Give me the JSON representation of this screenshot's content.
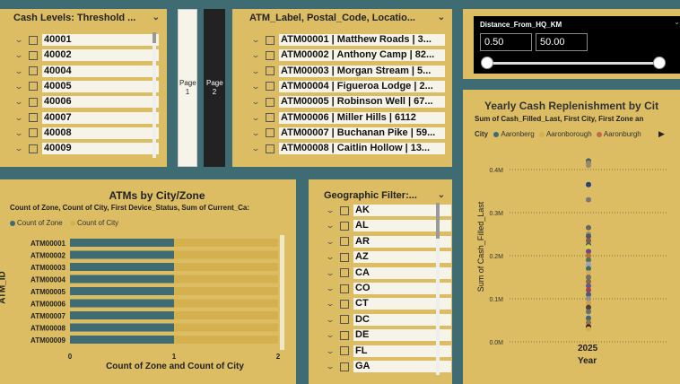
{
  "cash_slicer": {
    "title": "Cash Levels: Threshold ...",
    "items": [
      "40001",
      "40002",
      "40004",
      "40005",
      "40006",
      "40007",
      "40008",
      "40009"
    ]
  },
  "page_nav": {
    "page1": "Page 1",
    "page2": "Page 2"
  },
  "atm_slicer": {
    "title": "ATM_Label, Postal_Code, Locatio...",
    "items": [
      "ATM00001 | Matthew Roads | 3...",
      "ATM00002 | Anthony Camp | 82...",
      "ATM00003 | Morgan Stream | 5...",
      "ATM00004 | Figueroa Lodge | 2...",
      "ATM00005 | Robinson Well | 67...",
      "ATM00006 | Miller Hills | 6112",
      "ATM00007 | Buchanan Pike | 59...",
      "ATM00008 | Caitlin Hollow | 13..."
    ]
  },
  "distance_slicer": {
    "title": "Distance_From_HQ_KM",
    "min": "0.50",
    "max": "50.00",
    "fill_fraction": 1.0
  },
  "bar_chart": {
    "title": "ATMs by City/Zone",
    "subtitle": "Count of Zone, Count of City, First Device_Status, Sum of Current_Ca:",
    "legend": [
      "Count of Zone",
      "Count of City"
    ],
    "ylabel": "ATM_ID",
    "xlabel": "Count of Zone and Count of City",
    "xticks": [
      "0",
      "1",
      "2"
    ]
  },
  "geo_slicer": {
    "title": "Geographic Filter:...",
    "items": [
      "AK",
      "AL",
      "AR",
      "AZ",
      "CA",
      "CO",
      "CT",
      "DC",
      "DE",
      "FL",
      "GA"
    ]
  },
  "scatter_chart": {
    "title": "Yearly Cash Replenishment by Cit",
    "subtitle": "Sum of Cash_Filled_Last, First City, First Zone an",
    "legend_label": "City",
    "legend": [
      "Aaronberg",
      "Aaronborough",
      "Aaronburgh"
    ],
    "legend_colors": [
      "#3d6b75",
      "#d4b14e",
      "#c06a4a"
    ],
    "ylabel": "Sum of Cash_Filled_Last",
    "xlabel": "Year",
    "yticks": [
      "0.4M",
      "0.3M",
      "0.2M",
      "0.1M",
      "0.0M"
    ],
    "xtick": "2025"
  },
  "chart_data": [
    {
      "type": "bar",
      "categories": [
        "ATM00001",
        "ATM00002",
        "ATM00003",
        "ATM00004",
        "ATM00005",
        "ATM00006",
        "ATM00007",
        "ATM00008",
        "ATM00009"
      ],
      "series": [
        {
          "name": "Count of Zone",
          "values": [
            1,
            1,
            1,
            1,
            1,
            1,
            1,
            1,
            1
          ]
        },
        {
          "name": "Count of City",
          "values": [
            1,
            1,
            1,
            1,
            1,
            1,
            1,
            1,
            1
          ]
        }
      ],
      "stacked": true,
      "xlim": [
        0,
        2
      ],
      "colors": [
        "#3f6c72",
        "#d4b14e"
      ]
    },
    {
      "type": "scatter",
      "x_category": "2025",
      "ylim": [
        0,
        0.45
      ],
      "y_unit": "M",
      "points": [
        {
          "y": 0.42,
          "c": "#555555"
        },
        {
          "y": 0.415,
          "c": "#888888"
        },
        {
          "y": 0.41,
          "c": "#9a8a6a"
        },
        {
          "y": 0.365,
          "c": "#2a3f7a"
        },
        {
          "y": 0.33,
          "c": "#7a7a7a"
        },
        {
          "y": 0.265,
          "c": "#666666"
        },
        {
          "y": 0.25,
          "c": "#b08d3c"
        },
        {
          "y": 0.245,
          "c": "#445577"
        },
        {
          "y": 0.235,
          "c": "#8a5a3a"
        },
        {
          "y": 0.225,
          "c": "#3d6b75"
        },
        {
          "y": 0.22,
          "c": "#e0d040"
        },
        {
          "y": 0.21,
          "c": "#6a4a8a"
        },
        {
          "y": 0.2,
          "c": "#c06a4a"
        },
        {
          "y": 0.19,
          "c": "#4a7a4a"
        },
        {
          "y": 0.18,
          "c": "#a0a0c0"
        },
        {
          "y": 0.17,
          "c": "#3d6b75"
        },
        {
          "y": 0.16,
          "c": "#d4b14e"
        },
        {
          "y": 0.15,
          "c": "#707070"
        },
        {
          "y": 0.14,
          "c": "#8b6b3a"
        },
        {
          "y": 0.13,
          "c": "#5a5a9a"
        },
        {
          "y": 0.12,
          "c": "#b04040"
        },
        {
          "y": 0.11,
          "c": "#406080"
        },
        {
          "y": 0.1,
          "c": "#909090"
        },
        {
          "y": 0.09,
          "c": "#c8a050"
        },
        {
          "y": 0.08,
          "c": "#5a3a2a"
        },
        {
          "y": 0.07,
          "c": "#607080"
        },
        {
          "y": 0.055,
          "c": "#3d6b75"
        },
        {
          "y": 0.045,
          "c": "#a07040"
        },
        {
          "y": 0.035,
          "c": "#222222"
        },
        {
          "y": 0.03,
          "c": "#d4b14e"
        }
      ]
    }
  ]
}
